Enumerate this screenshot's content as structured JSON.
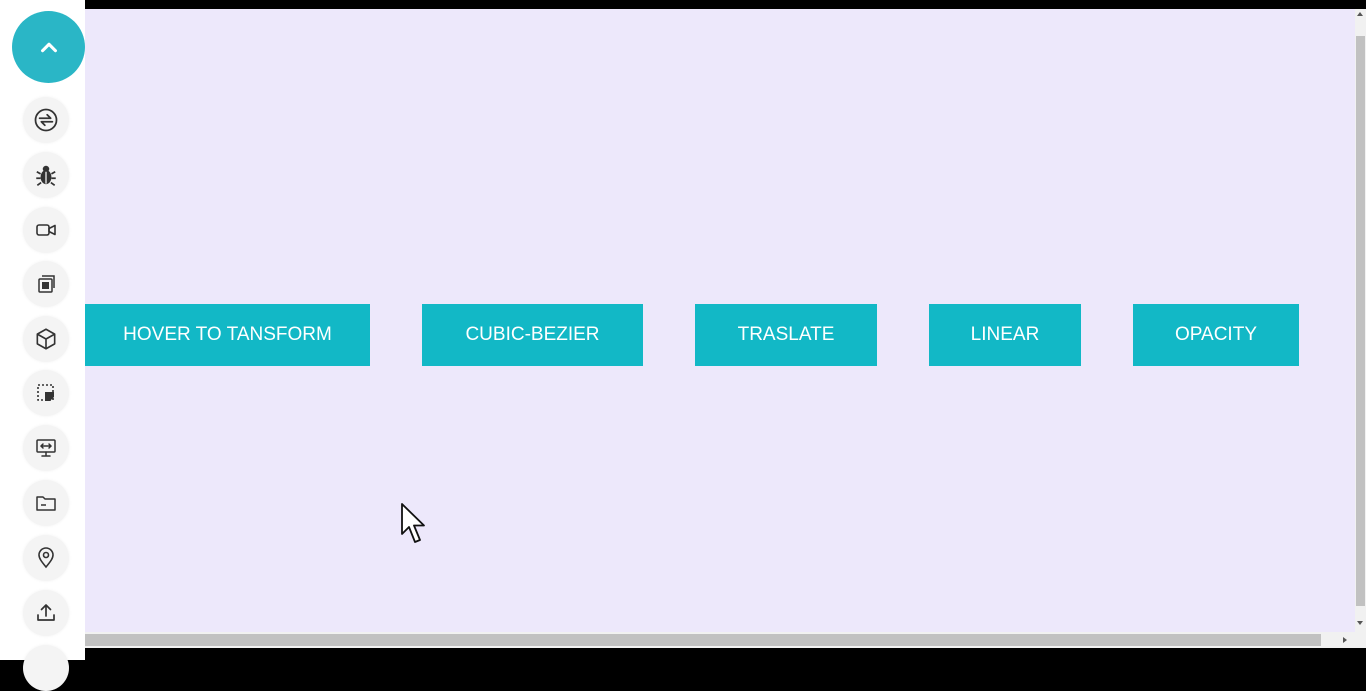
{
  "sidebar": {
    "toggle_icon": "chevron-up-icon",
    "tools": [
      {
        "icon": "exchange-icon"
      },
      {
        "icon": "bug-icon"
      },
      {
        "icon": "video-camera-icon"
      },
      {
        "icon": "copy-icon"
      },
      {
        "icon": "cube-icon"
      },
      {
        "icon": "select-area-icon"
      },
      {
        "icon": "monitor-icon"
      },
      {
        "icon": "folder-icon"
      },
      {
        "icon": "location-pin-icon"
      },
      {
        "icon": "upload-icon"
      }
    ]
  },
  "buttons": [
    {
      "label": "HOVER TO TANSFORM"
    },
    {
      "label": "CUBIC-BEZIER"
    },
    {
      "label": "TRASLATE"
    },
    {
      "label": "LINEAR"
    },
    {
      "label": "OPACITY"
    }
  ],
  "colors": {
    "accent": "#12b8c6",
    "toggle": "#2ab6c6",
    "background": "#ede8fb"
  }
}
